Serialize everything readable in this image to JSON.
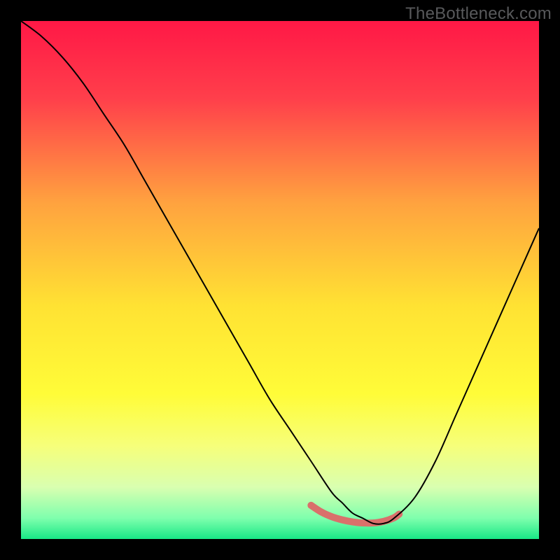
{
  "watermark": "TheBottleneck.com",
  "chart_data": {
    "type": "line",
    "title": "",
    "xlabel": "",
    "ylabel": "",
    "xlim": [
      0,
      100
    ],
    "ylim": [
      0,
      100
    ],
    "grid": false,
    "legend": false,
    "background_gradient_stops": [
      {
        "offset": 0.0,
        "color": "#ff1846"
      },
      {
        "offset": 0.15,
        "color": "#ff3f4b"
      },
      {
        "offset": 0.35,
        "color": "#ffa23f"
      },
      {
        "offset": 0.55,
        "color": "#ffe233"
      },
      {
        "offset": 0.72,
        "color": "#fffc38"
      },
      {
        "offset": 0.82,
        "color": "#f6ff7a"
      },
      {
        "offset": 0.9,
        "color": "#d9ffb0"
      },
      {
        "offset": 0.96,
        "color": "#7effad"
      },
      {
        "offset": 1.0,
        "color": "#18e886"
      }
    ],
    "series": [
      {
        "name": "bottleneck-curve",
        "color": "#000000",
        "stroke_width": 2,
        "x": [
          0,
          4,
          8,
          12,
          16,
          20,
          24,
          28,
          32,
          36,
          40,
          44,
          48,
          52,
          56,
          60,
          62,
          64,
          66,
          68,
          70,
          72,
          76,
          80,
          84,
          88,
          92,
          96,
          100
        ],
        "y": [
          100,
          97,
          93,
          88,
          82,
          76,
          69,
          62,
          55,
          48,
          41,
          34,
          27,
          21,
          15,
          9,
          7,
          5,
          4,
          3,
          3,
          4,
          8,
          15,
          24,
          33,
          42,
          51,
          60
        ]
      }
    ],
    "highlight_band": {
      "name": "optimal-range",
      "color": "#d9706b",
      "radius": 5,
      "points_x": [
        56,
        58,
        60,
        62,
        64,
        66,
        68,
        70,
        72,
        73
      ],
      "points_y": [
        6.5,
        5.2,
        4.3,
        3.7,
        3.3,
        3.1,
        3.1,
        3.4,
        4.1,
        4.8
      ]
    }
  }
}
